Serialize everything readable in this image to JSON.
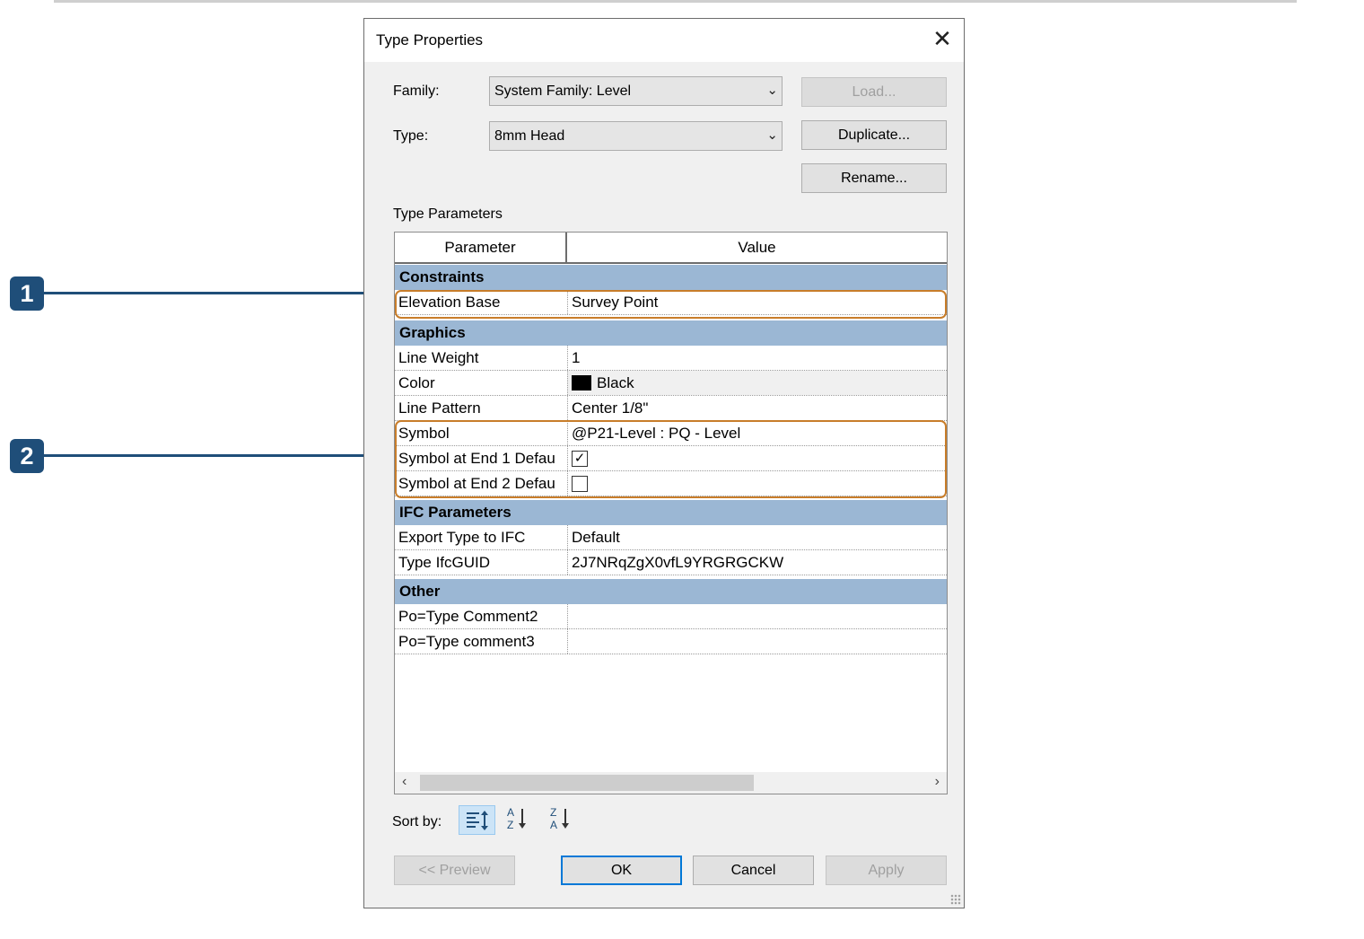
{
  "callouts": [
    "1",
    "2"
  ],
  "dialog": {
    "title": "Type Properties",
    "family_label": "Family:",
    "family_value": "System Family: Level",
    "type_label": "Type:",
    "type_value": "8mm Head",
    "load_label": "Load...",
    "duplicate_label": "Duplicate...",
    "rename_label": "Rename...",
    "type_parameters_label": "Type Parameters",
    "grid": {
      "col_parameter": "Parameter",
      "col_value": "Value",
      "sections": [
        {
          "name": "Constraints",
          "rows": [
            {
              "param": "Elevation Base",
              "value": "Survey Point"
            }
          ]
        },
        {
          "name": "Graphics",
          "rows": [
            {
              "param": "Line Weight",
              "value": "1"
            },
            {
              "param": "Color",
              "value": "Black"
            },
            {
              "param": "Line Pattern",
              "value": "Center 1/8\""
            },
            {
              "param": "Symbol",
              "value": "@P21-Level : PQ - Level"
            },
            {
              "param": "Symbol at End 1 Defau",
              "checked": true
            },
            {
              "param": "Symbol at End 2 Defau",
              "checked": false
            }
          ]
        },
        {
          "name": "IFC Parameters",
          "rows": [
            {
              "param": "Export Type to IFC",
              "value": "Default"
            },
            {
              "param": "Type IfcGUID",
              "value": "2J7NRqZgX0vfL9YRGRGCKW"
            }
          ]
        },
        {
          "name": "Other",
          "rows": [
            {
              "param": "Po=Type Comment2",
              "value": ""
            },
            {
              "param": "Po=Type comment3",
              "value": ""
            }
          ]
        }
      ]
    },
    "sort_by_label": "Sort by:",
    "sort_az_glyph": "A Z",
    "sort_za_glyph": "Z A",
    "preview_label": "<< Preview",
    "ok_label": "OK",
    "cancel_label": "Cancel",
    "apply_label": "Apply"
  },
  "colors": {
    "accent": "#0078d7",
    "callout": "#1f4e79",
    "highlight": "#c87d2a",
    "section": "#9bb7d4"
  }
}
